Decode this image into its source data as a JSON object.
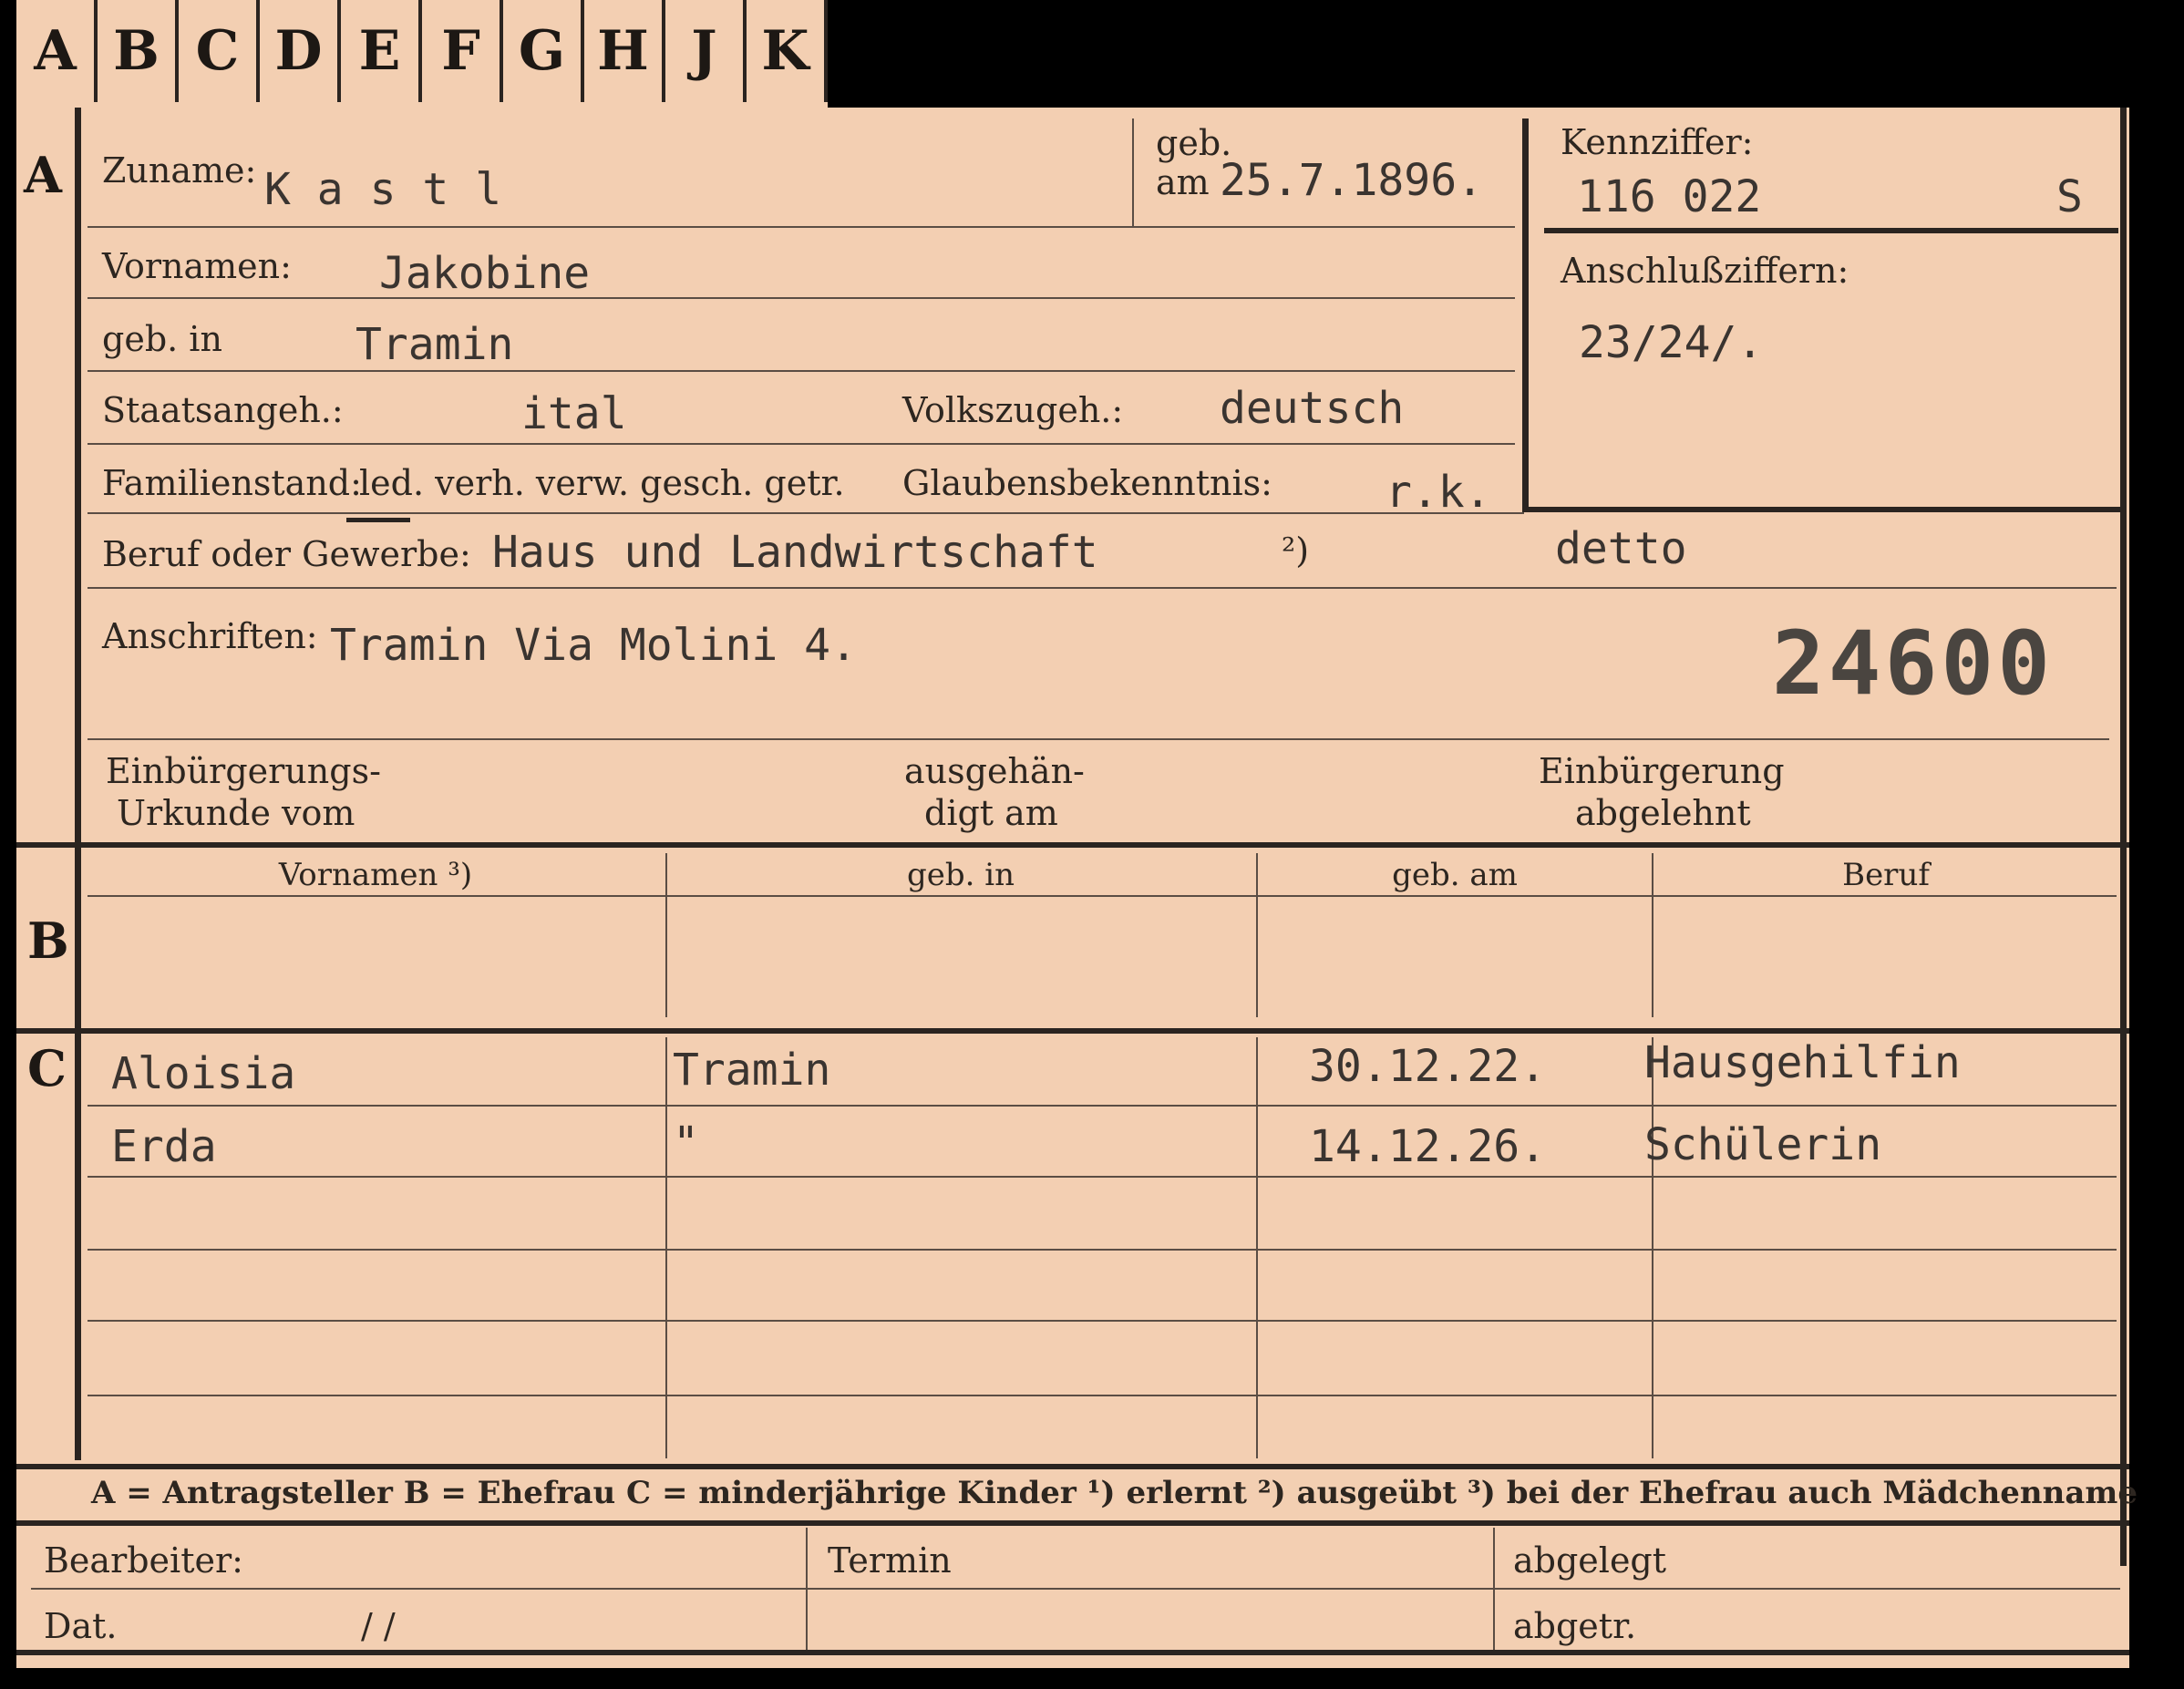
{
  "tabs": [
    "A",
    "B",
    "C",
    "D",
    "E",
    "F",
    "G",
    "H",
    "J",
    "K"
  ],
  "section_a": {
    "letter": "A",
    "zuname_label": "Zuname:",
    "zuname_value": "K a s t l",
    "geb_label": "geb.",
    "am_label": "am",
    "geb_am_value": "25.7.1896.",
    "kennziffer_label": "Kennziffer:",
    "kennziffer_value": "116 022",
    "kennziffer_suffix": "S",
    "vornamen_label": "Vornamen:",
    "vornamen_value": "Jakobine",
    "anschluss_label": "Anschlußziffern:",
    "anschluss_value": "23/24/.",
    "geb_in_label": "geb. in",
    "geb_in_value": "Tramin",
    "staatsangeh_label": "Staatsangeh.:",
    "staatsangeh_value": "ital",
    "volkszugeh_label": "Volkszugeh.:",
    "volkszugeh_value": "deutsch",
    "familienstand_label": "Familienstand:",
    "familienstand_options": "led. verh. verw. gesch. getr.",
    "glauben_label": "Glaubensbekenntnis:",
    "glauben_value": "r.k.",
    "beruf_label": "Beruf oder Gewerbe:",
    "beruf_value": "Haus und Landwirtschaft",
    "beruf_note": "²)",
    "beruf_value2": "detto",
    "anschriften_label": "Anschriften:",
    "anschriften_value": "Tramin Via Molini 4.",
    "stamp_number": "24600",
    "einb_urkunde_label_1": "Einbürgerungs-",
    "einb_urkunde_label_2": "Urkunde vom",
    "ausgehaendigt_label_1": "ausgehän-",
    "ausgehaendigt_label_2": "digt am",
    "einb_abgelehnt_label_1": "Einbürgerung",
    "einb_abgelehnt_label_2": "abgelehnt"
  },
  "section_b": {
    "letter": "B",
    "columns": [
      "Vornamen ³)",
      "geb. in",
      "geb. am",
      "Beruf"
    ]
  },
  "section_c": {
    "letter": "C",
    "rows": [
      {
        "vorname": "Aloisia",
        "geb_in": "Tramin",
        "geb_am": "30.12.22.",
        "beruf": "Hausgehilfin"
      },
      {
        "vorname": "Erda",
        "geb_in": "\"",
        "geb_am": "14.12.26.",
        "beruf": "Schülerin"
      }
    ]
  },
  "legend": "A = Antragsteller   B = Ehefrau   C = minderjährige Kinder   ¹) erlernt   ²) ausgeübt   ³) bei der Ehefrau auch Mädchenname",
  "footer": {
    "bearbeiter_label": "Bearbeiter:",
    "dat_label": "Dat.",
    "dat_slashes": "/                /",
    "termin_label": "Termin",
    "abgelegt_label": "abgelegt",
    "abgetr_label": "abgetr."
  }
}
